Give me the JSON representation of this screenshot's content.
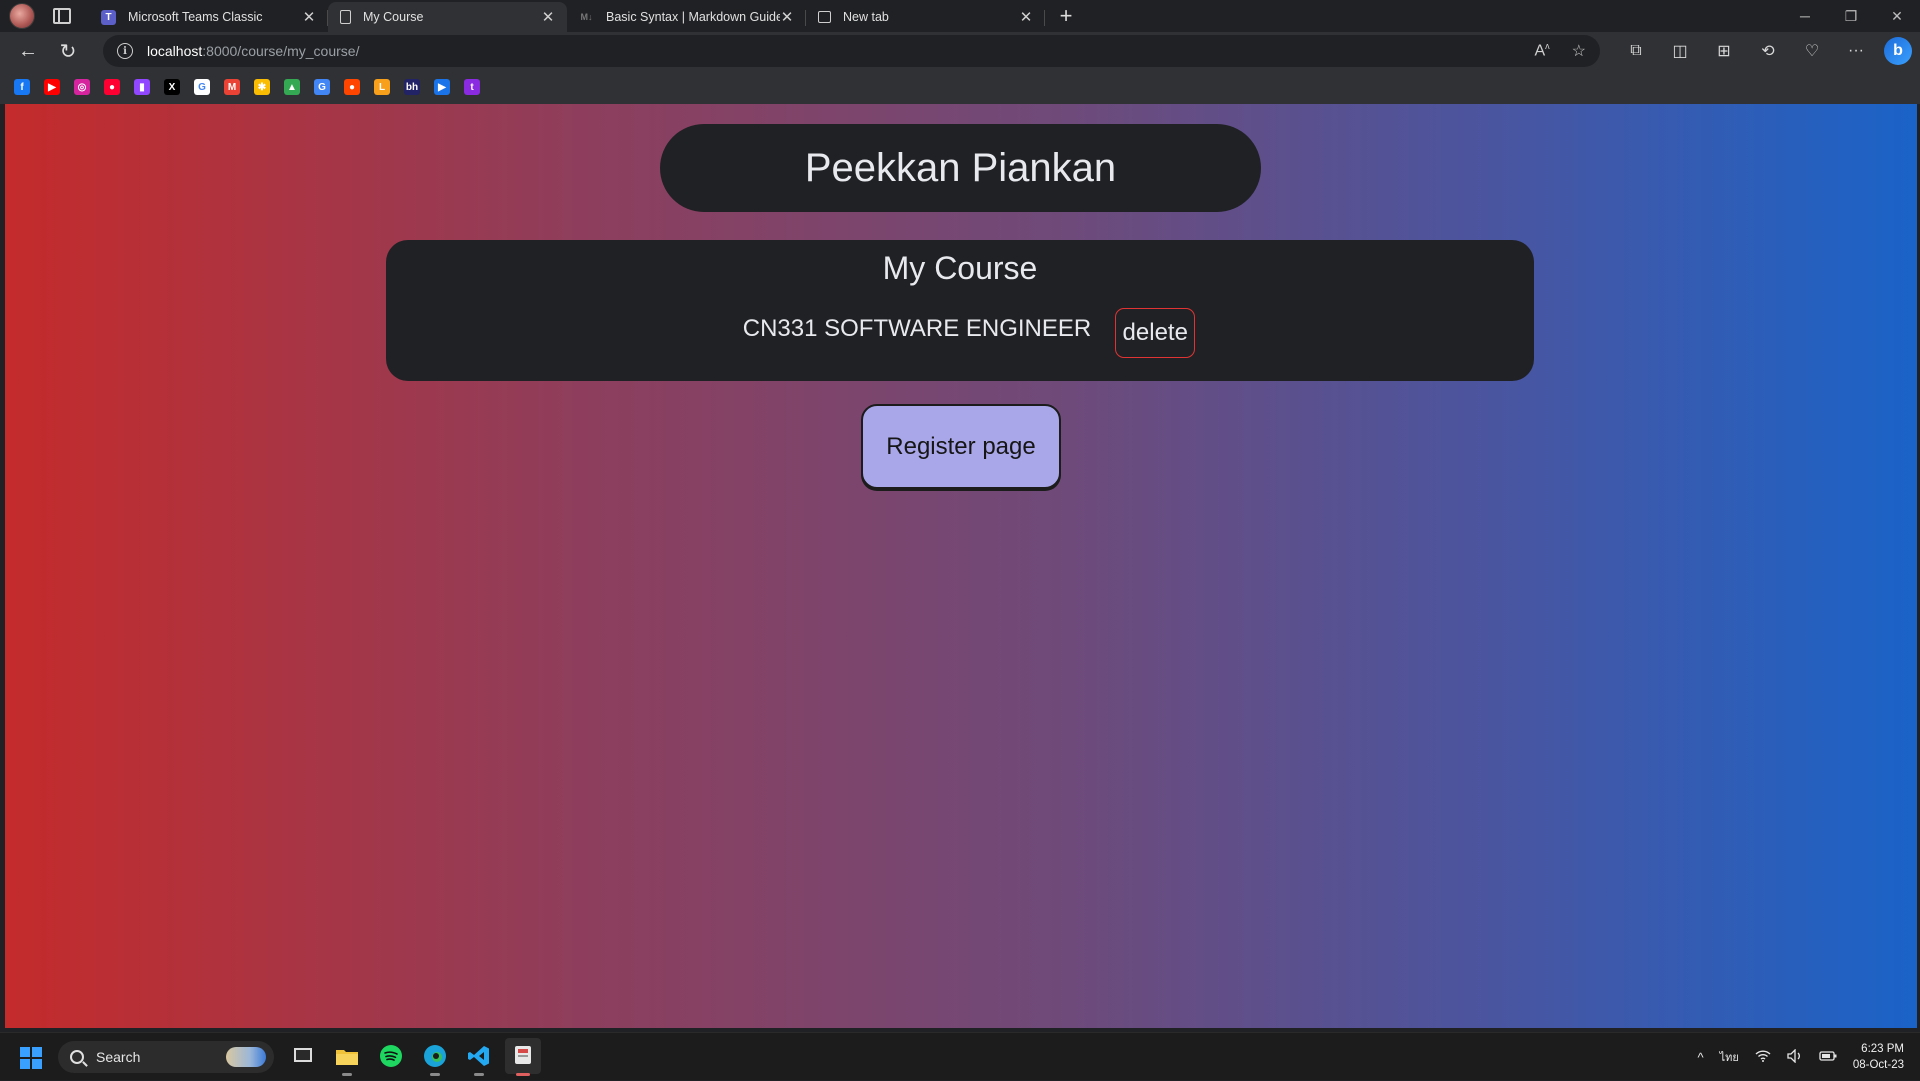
{
  "browser": {
    "tabs": [
      {
        "title": "Microsoft Teams Classic",
        "icon": "teams-icon",
        "active": false
      },
      {
        "title": "My Course",
        "icon": "page-icon",
        "active": true
      },
      {
        "title": "Basic Syntax | Markdown Guide",
        "icon": "markdown-icon",
        "active": false
      },
      {
        "title": "New tab",
        "icon": "newtab-icon",
        "active": false
      }
    ],
    "address": {
      "host": "localhost",
      "rest": ":8000/course/my_course/"
    },
    "bookmarks": [
      {
        "icon": "facebook-icon",
        "glyph": "f",
        "color": "#1877f2"
      },
      {
        "icon": "youtube-icon",
        "glyph": "▶",
        "color": "#ff0000"
      },
      {
        "icon": "instagram-icon",
        "glyph": "◎",
        "color": "#d6249f"
      },
      {
        "icon": "youtube-music-icon",
        "glyph": "●",
        "color": "#ff0033"
      },
      {
        "icon": "twitch-icon",
        "glyph": "▮",
        "color": "#9146ff"
      },
      {
        "icon": "x-icon",
        "glyph": "X",
        "color": "#000000"
      },
      {
        "icon": "google-icon",
        "glyph": "G",
        "color": "#ffffff"
      },
      {
        "icon": "gmail-icon",
        "glyph": "M",
        "color": "#ea4335"
      },
      {
        "icon": "photos-icon",
        "glyph": "✱",
        "color": "#fbbc04"
      },
      {
        "icon": "drive-icon",
        "glyph": "▲",
        "color": "#34a853"
      },
      {
        "icon": "translate-icon",
        "glyph": "G",
        "color": "#4285f4"
      },
      {
        "icon": "reddit-icon",
        "glyph": "●",
        "color": "#ff4500"
      },
      {
        "icon": "leetcode-icon",
        "glyph": "L",
        "color": "#f89f1b"
      },
      {
        "icon": "bh-icon",
        "glyph": "bh",
        "color": "#222266"
      },
      {
        "icon": "play-icon",
        "glyph": "▶",
        "color": "#1a73e8"
      },
      {
        "icon": "tw-icon",
        "glyph": "t",
        "color": "#8a2be2"
      }
    ]
  },
  "page": {
    "brand": "Peekkan Piankan",
    "card_title": "My Course",
    "courses": [
      {
        "name": "CN331 SOFTWARE ENGINEER",
        "action": "delete"
      }
    ],
    "register_label": "Register page"
  },
  "taskbar": {
    "search_label": "Search",
    "lang": "ไทย",
    "time": "6:23 PM",
    "date": "08-Oct-23"
  }
}
